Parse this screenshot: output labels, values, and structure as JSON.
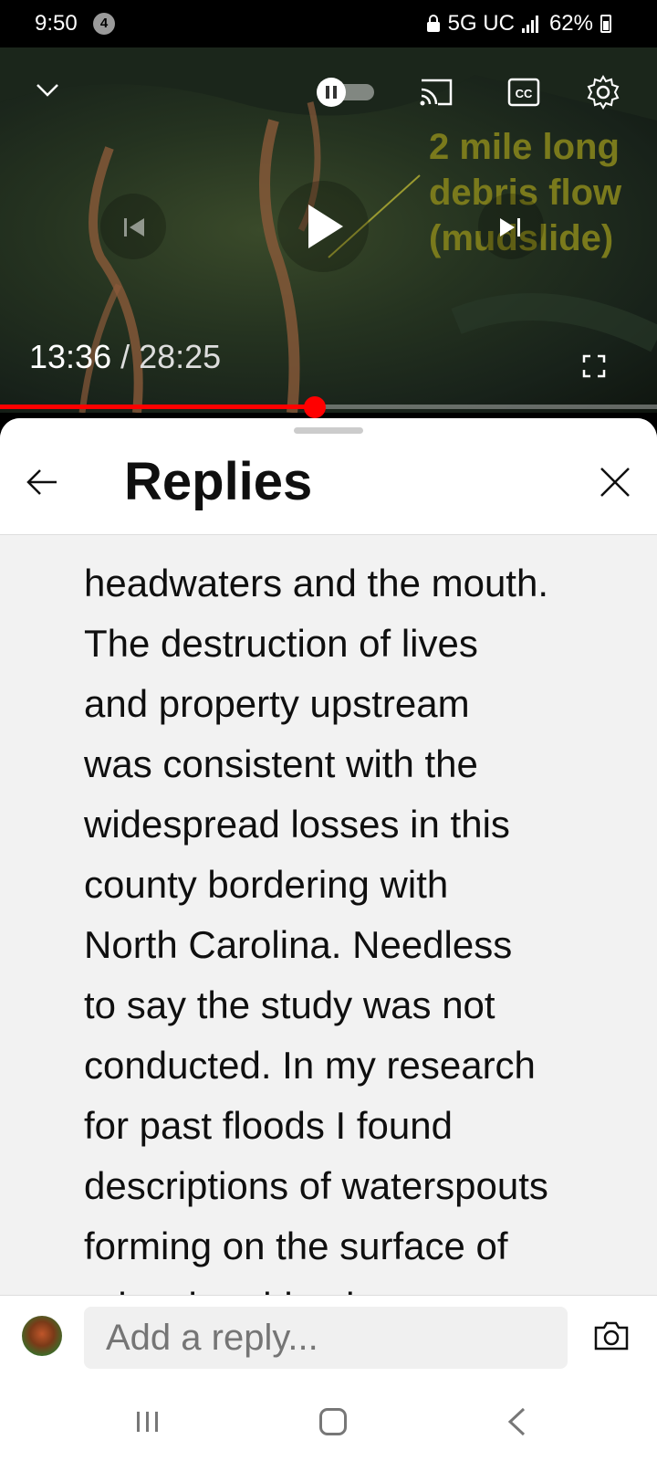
{
  "status_bar": {
    "time": "9:50",
    "notification_count": "4",
    "network": "5G UC",
    "battery": "62%"
  },
  "video": {
    "overlay_caption": [
      "2 mile long",
      "debris flow",
      "(mudslide)"
    ],
    "current_time": "13:36",
    "separator": " / ",
    "duration": "28:25",
    "progress_fraction": 0.479,
    "icons": [
      "chevron-down-icon",
      "autoplay-toggle-icon",
      "cast-icon",
      "captions-icon",
      "settings-icon",
      "previous-icon",
      "play-icon",
      "next-icon",
      "fullscreen-icon"
    ]
  },
  "replies_panel": {
    "title": "Replies",
    "reply_text_lines": [
      "headwaters and the mouth.",
      "The destruction of lives",
      "and property upstream",
      "was consistent with the",
      "widespread losses in this",
      "county bordering with",
      "North Carolina. Needless",
      "to say the study was not",
      "conducted. In my research",
      "for past floods I found",
      "descriptions of waterspouts",
      "forming on the surface of",
      "rains thrashing its"
    ]
  },
  "reply_bar": {
    "placeholder": "Add a reply..."
  },
  "colors": {
    "accent_red": "#ff0000",
    "overlay_text": "#7a7a1c",
    "sheet_bg": "#ffffff",
    "content_bg": "#f2f2f2"
  }
}
